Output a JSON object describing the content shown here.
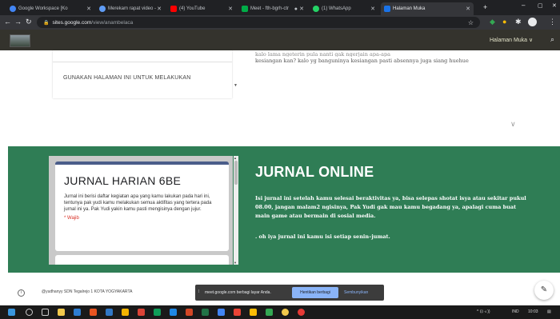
{
  "browser": {
    "tabs": [
      {
        "label": "Google Workspace [Ko",
        "color": "#4285f4",
        "active": false
      },
      {
        "label": "Merekam rapat video -",
        "color": "#5f9cf5",
        "active": false
      },
      {
        "label": "(4) YouTube",
        "color": "#ff0000",
        "active": false
      },
      {
        "label": "Meet - fth-bgrh-ctr",
        "color": "#00ac47",
        "active": false
      },
      {
        "label": "(1) WhatsApp",
        "color": "#25d366",
        "active": false
      },
      {
        "label": "Halaman Muka",
        "color": "#1a73e8",
        "active": true
      }
    ],
    "new_tab": "+",
    "url_host": "sites.google.com",
    "url_path": "/view/anambelaca"
  },
  "site": {
    "page_menu": "Halaman Muka ∨",
    "top_card_text": "GUNAKAN HALAMAN INI UNTUK MELAKUKAN",
    "top_body_clipped": "kalo lama ngeterin pula nanti gak ngerjain apa-apa",
    "top_body_line": "kesiangan kan? kalo yg banguninya kesiangan pasti absennya juga siang huehue",
    "form_title": "JURNAL HARIAN 6BE",
    "form_desc": "Jurnal ini berisi daftar kegiatan apa yang kamu lakukan pada hari ini, tentunya pak yudi kamu melakukan semua aktifitas yang tertera pada jurnal ini ya. Pak Yudi yakin kamu pasti mengisinya dengan jujur.",
    "form_required": "* Wajib",
    "section_title": "JURNAL ONLINE",
    "section_text": "Isi jurnal ini setelah kamu selesai beraktivitas ya, bisa selepas shotat isya atau sekitar pukul 08.00, jangan malam2 ngisinya, Pak Yudi gak mau kamu begadang ya, apalagi cuma buat main game atau bermain di sosial media.",
    "section_note": ". oh iya jurnal ini kamu isi setiap senin–jumat.",
    "footer_copy": "@yudhanyy SDN Tegalrejo 1 KOTA YOGYAKARTA"
  },
  "share_bar": {
    "message": "meet.google.com berbagi layar Anda.",
    "stop_label": "Hentikan berbagi",
    "hide_label": "Sembunyikan"
  },
  "taskbar": {
    "lang": "IND",
    "time": "10:03"
  },
  "colors": {
    "green_section": "#2f7d55",
    "site_header": "#34332d",
    "form_accent": "#4a5d8a"
  }
}
